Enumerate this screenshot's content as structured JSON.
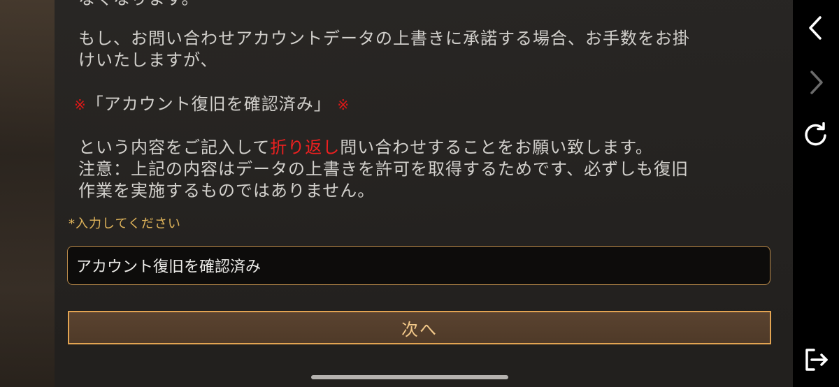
{
  "content": {
    "partial_top_line": "なくなります。",
    "paragraph1_line1": "もし、お問い合わせアカウントデータの上書きに承諾する場合、お手数をお掛",
    "paragraph1_line2": "けいたしますが、",
    "mark": "※",
    "quote_text": "「アカウント復旧を確認済み」",
    "instruction_before": "という内容をご記入して",
    "instruction_red": "折り返し",
    "instruction_after": "問い合わせすることをお願い致します。",
    "note_line1": "注意：上記の内容はデータの上書きを許可を取得するためです、必ずしも復旧",
    "note_line2": "作業を実施するものではありません。"
  },
  "form": {
    "required_label": "*入力してください",
    "input_value": "アカウント復旧を確認済み",
    "next_button_label": "次へ"
  },
  "nav": {
    "back_icon": "chevron-left-icon",
    "forward_icon": "chevron-right-icon",
    "reload_icon": "reload-icon",
    "exit_icon": "exit-icon"
  },
  "colors": {
    "accent_gold": "#e3a452",
    "emphasis_red": "#ee2020",
    "panel_bg": "#282624",
    "nav_bg": "#000000"
  }
}
